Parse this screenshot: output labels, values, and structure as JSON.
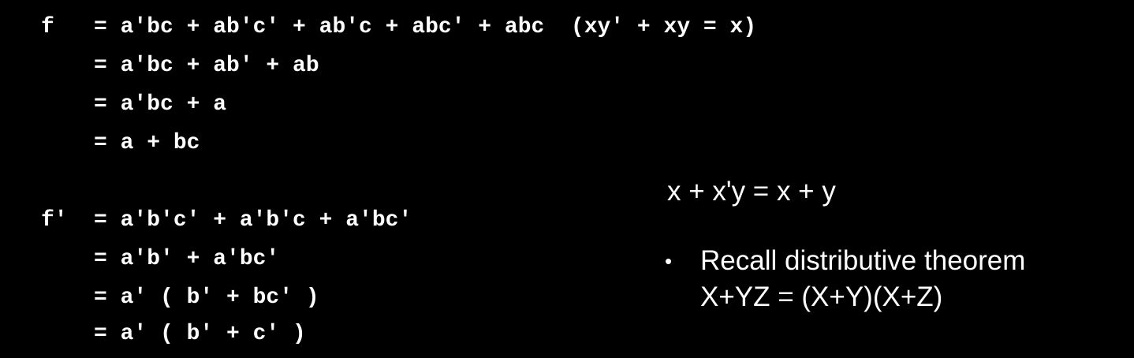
{
  "derivation_f": {
    "lines": [
      {
        "lhs": "f ",
        "rhs": "= a'bc + ab'c' + ab'c + abc′ + abc  (xy' + xy = x)"
      },
      {
        "lhs": "",
        "rhs": "= a'bc + ab' + ab"
      },
      {
        "lhs": "",
        "rhs": "= a'bc + a"
      },
      {
        "lhs": "",
        "rhs": "= a + bc"
      }
    ]
  },
  "derivation_f_prime": {
    "lines": [
      {
        "lhs": "f'",
        "rhs": "= a'b'c' + a'b'c + a'bc'"
      },
      {
        "lhs": "",
        "rhs": "= a'b' + a'bc'"
      },
      {
        "lhs": "",
        "rhs": "= a' ( b' + bc' )"
      },
      {
        "lhs": "",
        "rhs": "= a' ( b' + c' )"
      }
    ]
  },
  "theorem": {
    "identity": "x + x'y = x + y",
    "bullet_symbol": "•",
    "bullet_text": "Recall distributive theorem",
    "bullet_formula": "X+YZ = (X+Y)(X+Z)"
  }
}
